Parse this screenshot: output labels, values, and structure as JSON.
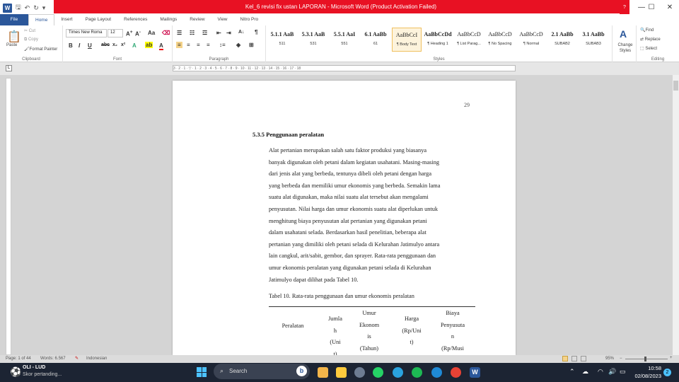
{
  "window": {
    "title": "Kel_6 revisi fix ustan LAPORAN  -  Microsoft Word (Product Activation Failed)",
    "help": "?",
    "minimize": "—",
    "maximize": "☐",
    "close": "✕"
  },
  "tabs": [
    {
      "label": "File"
    },
    {
      "label": "Home"
    },
    {
      "label": "Insert"
    },
    {
      "label": "Page Layout"
    },
    {
      "label": "References"
    },
    {
      "label": "Mailings"
    },
    {
      "label": "Review"
    },
    {
      "label": "View"
    },
    {
      "label": "Nitro Pro"
    }
  ],
  "clipboard": {
    "paste": "Paste",
    "cut": "Cut",
    "copy": "Copy",
    "format_painter": "Format Painter",
    "group": "Clipboard"
  },
  "font": {
    "name": "Times New Roma",
    "size": "12",
    "group": "Font"
  },
  "paragraph": {
    "group": "Paragraph"
  },
  "styles": {
    "group": "Styles",
    "items": [
      {
        "preview": "5.1.1 AaB",
        "name": "511"
      },
      {
        "preview": "5.3.1 AaB",
        "name": "531"
      },
      {
        "preview": "5.5.1 AaI",
        "name": "551"
      },
      {
        "preview": "6.1 AaBb",
        "name": "61"
      },
      {
        "preview": "AaBbCcI",
        "name": "¶ Body Text"
      },
      {
        "preview": "AaBbCcDd",
        "name": "¶ Heading 1"
      },
      {
        "preview": "AaBbCcD",
        "name": "¶ List Parag..."
      },
      {
        "preview": "AaBbCcD",
        "name": "¶ No Spacing"
      },
      {
        "preview": "AaBbCcD",
        "name": "¶ Normal"
      },
      {
        "preview": "2.1 AaBb",
        "name": "SUBAB2"
      },
      {
        "preview": "3.1 AaBb",
        "name": "SUBAB3"
      }
    ],
    "change": "Change Styles"
  },
  "editing": {
    "find": "Find",
    "replace": "Replace",
    "select": "Select",
    "group": "Editing"
  },
  "ruler": {
    "marks": "3 · 2 · 1 · ▽ · 1 · 2 · 3 · 4 · 5 · 6 · 7 · 8 · 9 · 10 · 11 · 12 · 13 · 14 · 15 · 16 · 17 · 18"
  },
  "document": {
    "page_number": "29",
    "heading": "5.3.5  Penggunaan peralatan",
    "lines": [
      "Alat pertanian merupakan salah satu faktor produksi yang biasanya",
      "banyak digunakan oleh petani dalam kegiatan usahatani. Masing-masing",
      "dari jenis alat yang berbeda, tentunya dibeli oleh petani dengan harga",
      "yang berbeda dan memiliki umur ekonomis yang berbeda. Semakin lama",
      "suatu alat digunakan, maka nilai suatu alat tersebut akan mengalami",
      "penyusutan. Nilai harga dan umur ekonomis suatu alat diperlukan untuk",
      "menghitung biaya penyusutan alat pertanian yang digunakan petani",
      "dalam usahatani selada. Berdasarkan hasil penelitian, beberapa alat",
      "pertanian yang dimiliki oleh petani selada di Kelurahan Jatimulyo antara",
      "lain cangkul, arit/sabit,  gembor, dan sprayer. Rata-rata  penggunaan dan",
      "umur ekonomis peralatan yang digunakan petani selada di Kelurahan",
      "Jatimulyo dapat dilihat pada Tabel 10."
    ],
    "table_caption": "Tabel 10. Rata-rata penggunaan dan umur ekonomis peralatan",
    "table_headers": {
      "c1": [
        "Peralatan"
      ],
      "c2": [
        "Jumla",
        "h",
        "(Uni",
        "t)"
      ],
      "c3": [
        "Umur",
        "Ekonom",
        "is",
        "(Tahun)"
      ],
      "c4": [
        "Harga",
        "(Rp/Uni",
        "t)"
      ],
      "c5": [
        "Biaya",
        "Penyusuta",
        "n",
        "(Rp/Musi"
      ]
    }
  },
  "status": {
    "page": "Page: 1 of 44",
    "words": "Words: 6.567",
    "language": "Indonesian",
    "zoom": "95%"
  },
  "taskbar": {
    "weather_title": "OLI - LUD",
    "weather_sub": "Skor pertanding...",
    "search": "Search",
    "time": "10:58",
    "date": "02/08/2023",
    "badge": "2"
  }
}
